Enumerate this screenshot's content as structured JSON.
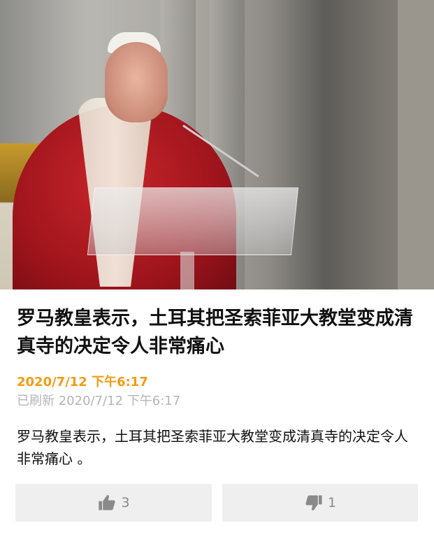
{
  "article": {
    "hero_image_alt": "Pope Francis speaking at a clear lectern",
    "headline": "罗马教皇表示，土耳其把圣索菲亚大教堂变成清真寺的决定令人非常痛心",
    "published": "2020/7/12 下午6:17",
    "refreshed": "已刷新 2020/7/12 下午6:17",
    "summary": "罗马教皇表示，土耳其把圣索菲亚大教堂变成清真寺的决定令人非常痛心 。"
  },
  "reactions": {
    "like_icon": "thumbs-up-icon",
    "like_count": "3",
    "dislike_icon": "thumbs-down-icon",
    "dislike_count": "1"
  },
  "colors": {
    "accent": "#f39c12",
    "muted_text": "#b5b5b5",
    "button_bg": "#efefef",
    "icon_gray": "#8a8a8a"
  }
}
